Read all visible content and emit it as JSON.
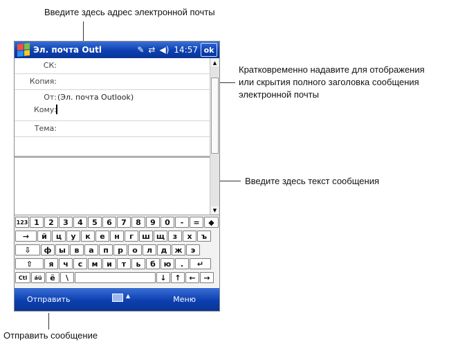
{
  "callouts": {
    "email_address": "Введите здесь адрес электронной почты",
    "header_toggle": [
      "Кратковременно надавите для отображения",
      "или скрытия полного заголовка сообщения",
      "электронной почты"
    ],
    "message_text": "Введите здесь текст сообщения",
    "send_message": "Отправить сообщение"
  },
  "titlebar": {
    "title": "Эл. почта Outl",
    "clock": "14:57",
    "ok_label": "ok",
    "icons": [
      "start-flag-icon",
      "edit-icon",
      "connectivity-icon",
      "speaker-icon"
    ]
  },
  "header": {
    "bcc": {
      "label": "СК:",
      "value": ""
    },
    "cc": {
      "label": "Копия:",
      "value": ""
    },
    "from": {
      "label": "От:",
      "value": "(Эл. почта Outlook)"
    },
    "to": {
      "label": "Кому:",
      "value": ""
    },
    "subject": {
      "label": "Тема:",
      "value": ""
    }
  },
  "keyboard": {
    "rows": [
      [
        "123",
        "1",
        "2",
        "3",
        "4",
        "5",
        "6",
        "7",
        "8",
        "9",
        "0",
        "-",
        "=",
        "◆"
      ],
      [
        "→",
        "й",
        "ц",
        "у",
        "к",
        "е",
        "н",
        "г",
        "ш",
        "щ",
        "з",
        "х",
        "ъ"
      ],
      [
        "⇩",
        "ф",
        "ы",
        "в",
        "а",
        "п",
        "р",
        "о",
        "л",
        "д",
        "ж",
        "э"
      ],
      [
        "⇧",
        "я",
        "ч",
        "с",
        "м",
        "и",
        "т",
        "ь",
        "б",
        "ю",
        ".",
        "↵"
      ],
      [
        "Ctl",
        "áü",
        "ё",
        "\\",
        "",
        "↓",
        "↑",
        "←",
        "→"
      ]
    ]
  },
  "menubar": {
    "left": "Отправить",
    "right": "Меню"
  }
}
